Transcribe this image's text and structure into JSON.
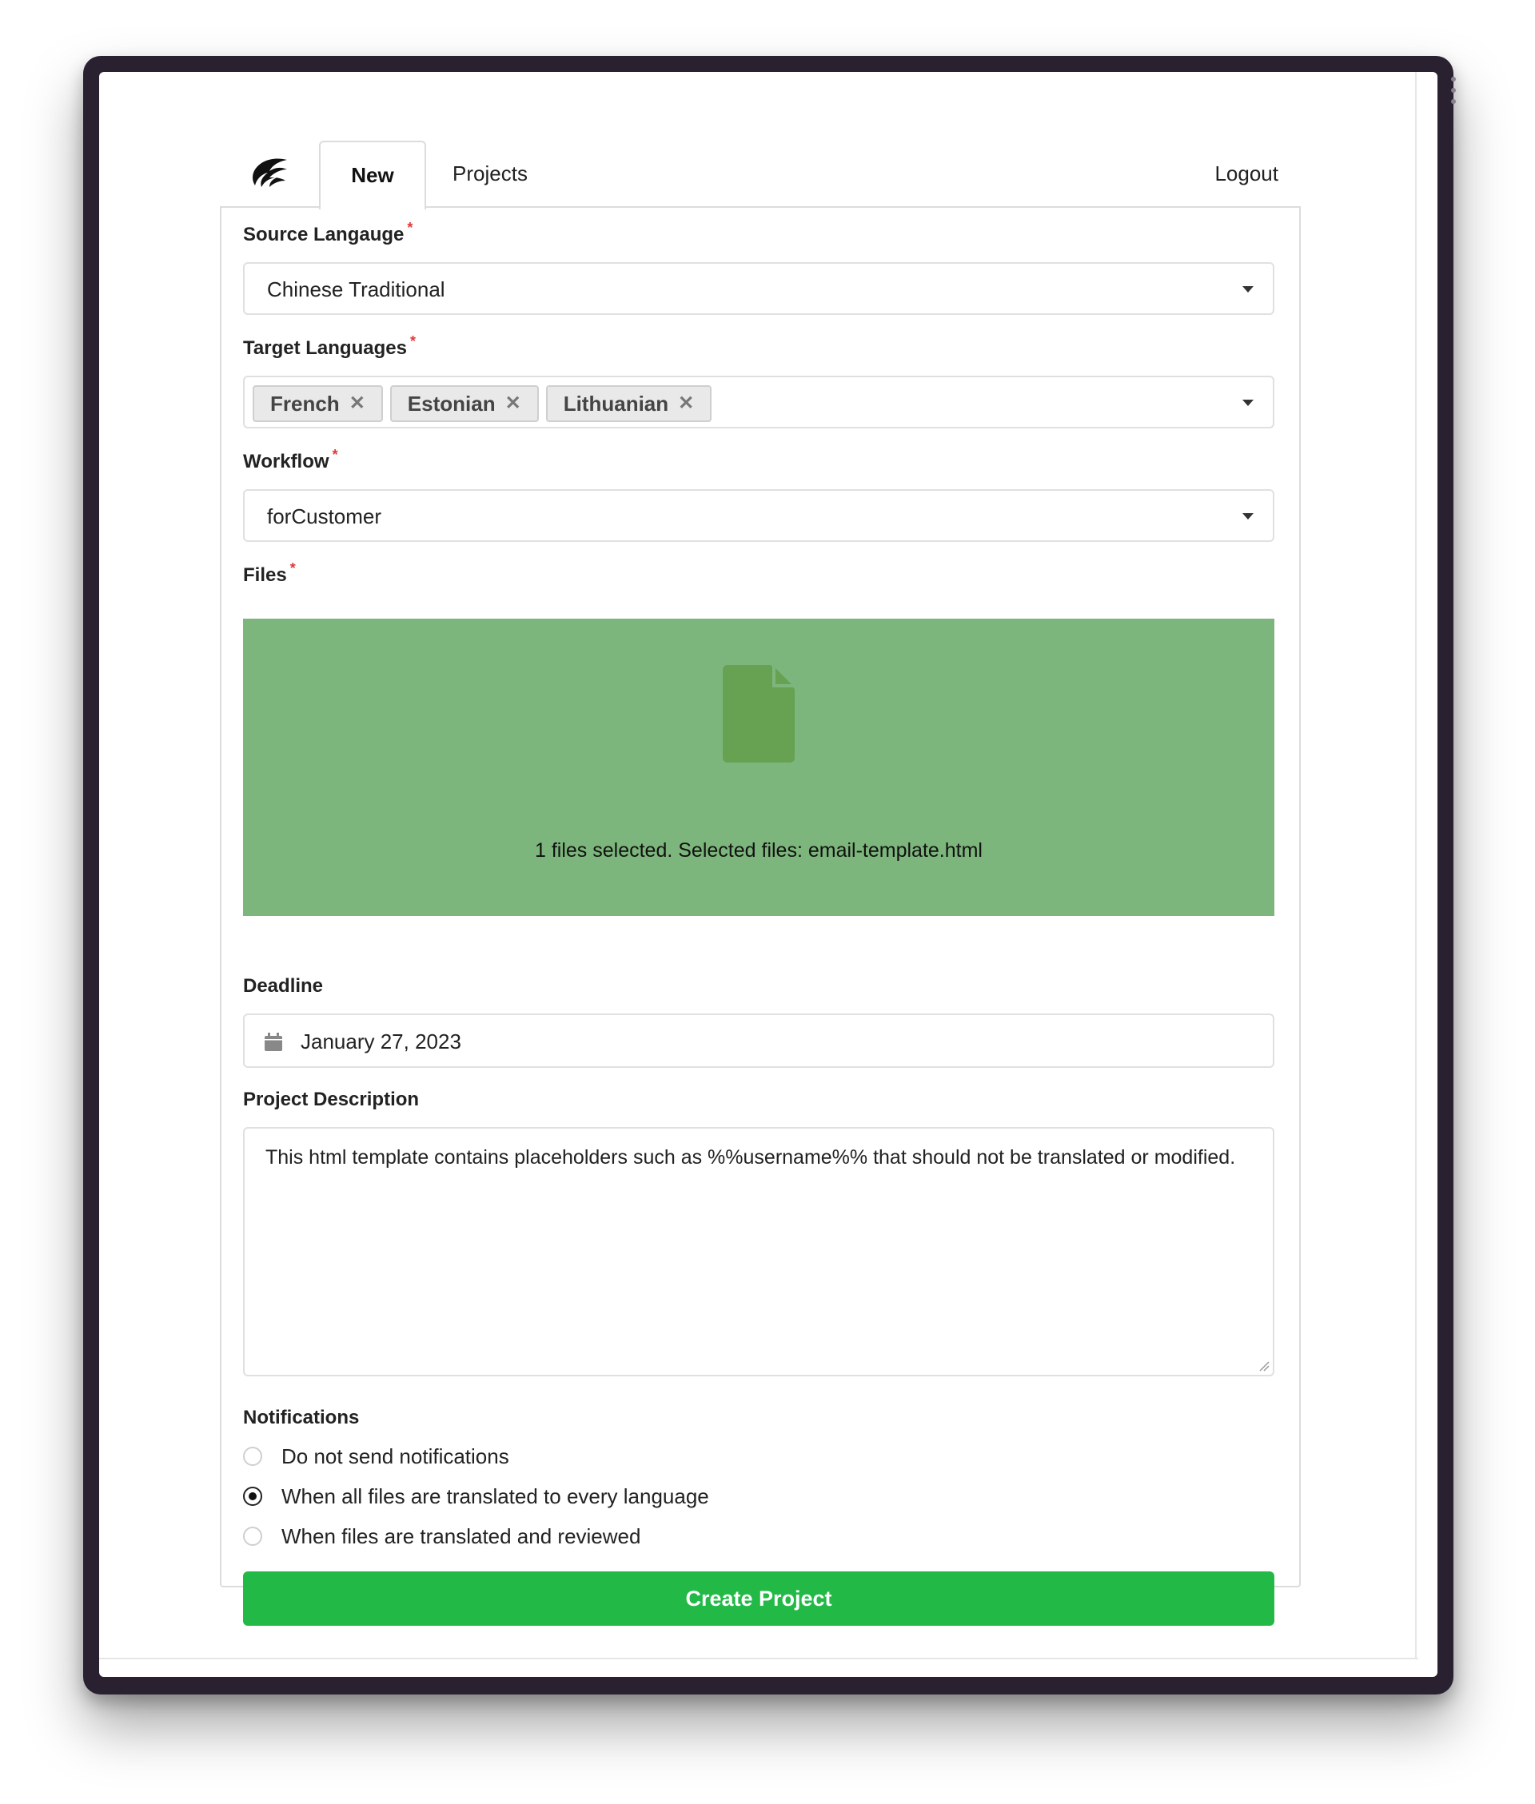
{
  "nav": {
    "logo_icon": "swift-bird-logo-icon",
    "tabs": [
      {
        "label": "New",
        "active": true
      },
      {
        "label": "Projects",
        "active": false
      }
    ],
    "logout_label": "Logout"
  },
  "form": {
    "source_language": {
      "label": "Source Langauge",
      "required_mark": "*",
      "value": "Chinese Traditional"
    },
    "target_languages": {
      "label": "Target Languages",
      "required_mark": "*",
      "chips": [
        "French",
        "Estonian",
        "Lithuanian"
      ],
      "remove_glyph": "✕"
    },
    "workflow": {
      "label": "Workflow",
      "required_mark": "*",
      "value": "forCustomer"
    },
    "files": {
      "label": "Files",
      "required_mark": "*",
      "icon": "file-icon",
      "status_text": "1 files selected. Selected files: email-template.html",
      "background_color": "#7db67c"
    },
    "deadline": {
      "label": "Deadline",
      "icon": "calendar-icon",
      "value": "January 27, 2023"
    },
    "description": {
      "label": "Project Description",
      "value": "This html template contains placeholders such as %%username%% that should not be translated or modified."
    },
    "notifications": {
      "label": "Notifications",
      "options": [
        {
          "label": "Do not send notifications",
          "selected": false
        },
        {
          "label": "When all files are translated to every language",
          "selected": true
        },
        {
          "label": "When files are translated and reviewed",
          "selected": false
        }
      ]
    },
    "submit_label": "Create Project",
    "submit_color": "#22b947"
  }
}
